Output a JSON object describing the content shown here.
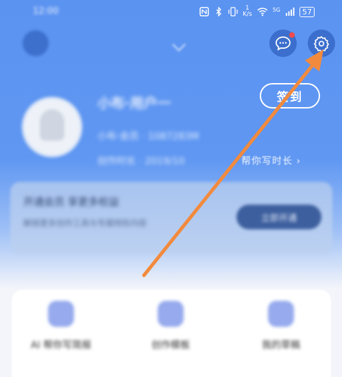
{
  "status_bar": {
    "time": "12:00",
    "speed_value": "1",
    "speed_unit": "K/s",
    "signal": "5G",
    "battery": "57"
  },
  "header": {
    "dropdown_icon": "chevron-down-icon",
    "message_icon": "message-bubble-icon",
    "settings_icon": "gear-icon"
  },
  "profile": {
    "name": "小布·用户一",
    "line1": "小布·会员 · 1087283M",
    "line2": "创作时长 · 2019/10",
    "checkin_label": "签到",
    "write_link": "帮你写时长 ›"
  },
  "banner": {
    "title": "开通会员 享更多权益",
    "subtitle": "解锁更多创作工具与专属特权内容",
    "button_label": "立即开通"
  },
  "quick_actions": [
    {
      "label": "AI 帮你写简报",
      "icon": "document-icon"
    },
    {
      "label": "创作模板",
      "icon": "template-icon"
    },
    {
      "label": "我的草稿",
      "icon": "draft-icon"
    }
  ],
  "colors": {
    "header_blue": "#5b93f1",
    "button_dark_blue": "#3c6fcd",
    "annotation_arrow": "#f28a3d",
    "notification_dot": "#f04a4a"
  }
}
